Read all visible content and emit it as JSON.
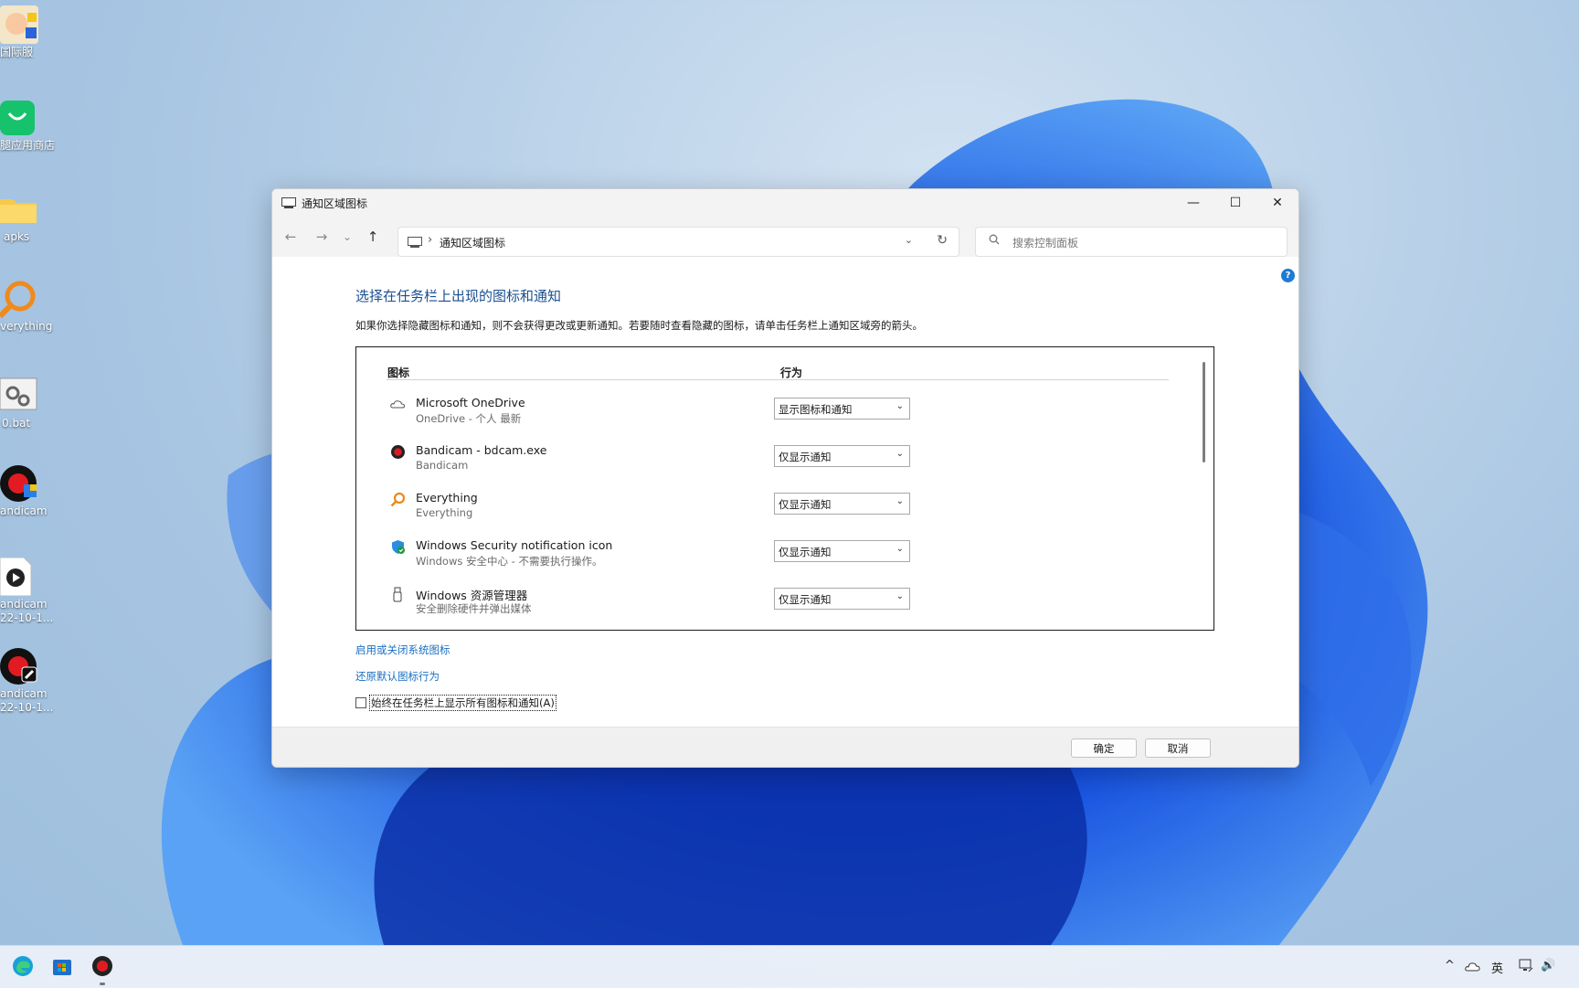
{
  "desktop": {
    "icons": [
      {
        "label": "国际服"
      },
      {
        "label": "腿应用商店"
      },
      {
        "label": "apks"
      },
      {
        "label": "verything"
      },
      {
        "label": "0.bat"
      },
      {
        "label": "andicam"
      },
      {
        "label": "andicam",
        "label2": "22-10-1..."
      },
      {
        "label": "andicam",
        "label2": "22-10-1..."
      }
    ]
  },
  "window": {
    "title": "通知区域图标",
    "controls": {
      "minimize": "—",
      "maximize": "☐",
      "close": "✕"
    },
    "nav": {
      "back": "←",
      "forward": "→",
      "recent": "⌄",
      "up": "↑"
    },
    "address": {
      "separator": "›",
      "path": "通知区域图标",
      "dropdown": "⌄",
      "refresh": "↻"
    },
    "search": {
      "placeholder": "搜索控制面板",
      "icon": "search-icon"
    },
    "help": "?",
    "heading": "选择在任务栏上出现的图标和通知",
    "description": "如果你选择隐藏图标和通知，则不会获得更改或更新通知。若要随时查看隐藏的图标，请单击任务栏上通知区域旁的箭头。",
    "columns": {
      "icon": "图标",
      "behavior": "行为"
    },
    "rows": [
      {
        "name": "Microsoft OneDrive",
        "sub": "OneDrive - 个人 最新",
        "behavior": "显示图标和通知",
        "icon": "cloud-icon"
      },
      {
        "name": "Bandicam - bdcam.exe",
        "sub": "Bandicam",
        "behavior": "仅显示通知",
        "icon": "record-icon"
      },
      {
        "name": "Everything",
        "sub": "Everything",
        "behavior": "仅显示通知",
        "icon": "magnifier-icon"
      },
      {
        "name": "Windows Security notification icon",
        "sub": "Windows 安全中心 - 不需要执行操作。",
        "behavior": "仅显示通知",
        "icon": "shield-icon"
      },
      {
        "name": "Windows 资源管理器",
        "sub": "安全删除硬件并弹出媒体",
        "behavior": "仅显示通知",
        "icon": "usb-icon"
      }
    ],
    "links": {
      "system_icons": "启用或关闭系统图标",
      "restore": "还原默认图标行为"
    },
    "checkbox": {
      "label": "始终在任务栏上显示所有图标和通知(A)",
      "checked": false
    },
    "buttons": {
      "ok": "确定",
      "cancel": "取消"
    }
  },
  "taskbar": {
    "apps": [
      "edge-icon",
      "store-icon",
      "bandicam-icon"
    ],
    "tray": {
      "chevron": "^",
      "ime": "英",
      "volume": "🔊"
    }
  },
  "colors": {
    "accent": "#1a6fc2",
    "heading": "#1a4f91",
    "wallpaper": "#b9d1e8"
  }
}
